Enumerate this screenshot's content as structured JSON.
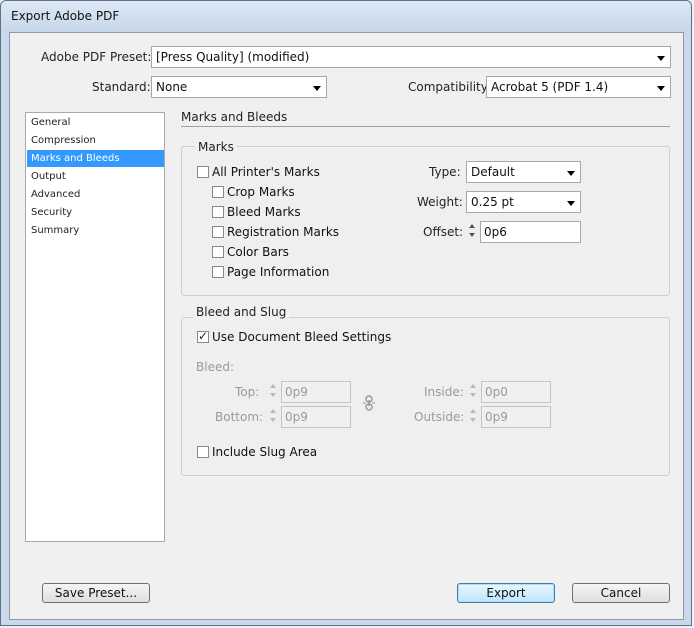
{
  "window": {
    "title": "Export Adobe PDF"
  },
  "preset": {
    "label": "Adobe PDF Preset:",
    "value": "[Press Quality] (modified)"
  },
  "standard": {
    "label": "Standard:",
    "value": "None"
  },
  "compatibility": {
    "label": "Compatibility:",
    "value": "Acrobat 5 (PDF 1.4)"
  },
  "nav": {
    "items": [
      "General",
      "Compression",
      "Marks and Bleeds",
      "Output",
      "Advanced",
      "Security",
      "Summary"
    ],
    "selected": "Marks and Bleeds"
  },
  "section_title": "Marks and Bleeds",
  "marks": {
    "group_label": "Marks",
    "all_printers_marks": {
      "label": "All Printer's Marks",
      "checked": false
    },
    "crop_marks": {
      "label": "Crop Marks",
      "checked": false
    },
    "bleed_marks": {
      "label": "Bleed Marks",
      "checked": false
    },
    "registration_marks": {
      "label": "Registration Marks",
      "checked": false
    },
    "color_bars": {
      "label": "Color Bars",
      "checked": false
    },
    "page_information": {
      "label": "Page Information",
      "checked": false
    },
    "type": {
      "label": "Type:",
      "value": "Default"
    },
    "weight": {
      "label": "Weight:",
      "value": "0.25 pt"
    },
    "offset": {
      "label": "Offset:",
      "value": "0p6"
    }
  },
  "bleed_slug": {
    "group_label": "Bleed and Slug",
    "use_document_bleed": {
      "label": "Use Document Bleed Settings",
      "checked": true
    },
    "bleed_label": "Bleed:",
    "top": {
      "label": "Top:",
      "value": "0p9"
    },
    "bottom": {
      "label": "Bottom:",
      "value": "0p9"
    },
    "inside": {
      "label": "Inside:",
      "value": "0p0"
    },
    "outside": {
      "label": "Outside:",
      "value": "0p9"
    },
    "include_slug": {
      "label": "Include Slug Area",
      "checked": false
    }
  },
  "buttons": {
    "save_preset": "Save Preset...",
    "export": "Export",
    "cancel": "Cancel"
  },
  "colors": {
    "selection": "#3399ff",
    "dialog_bg": "#f0f0f0",
    "title_bar": "#c9d8ea"
  }
}
